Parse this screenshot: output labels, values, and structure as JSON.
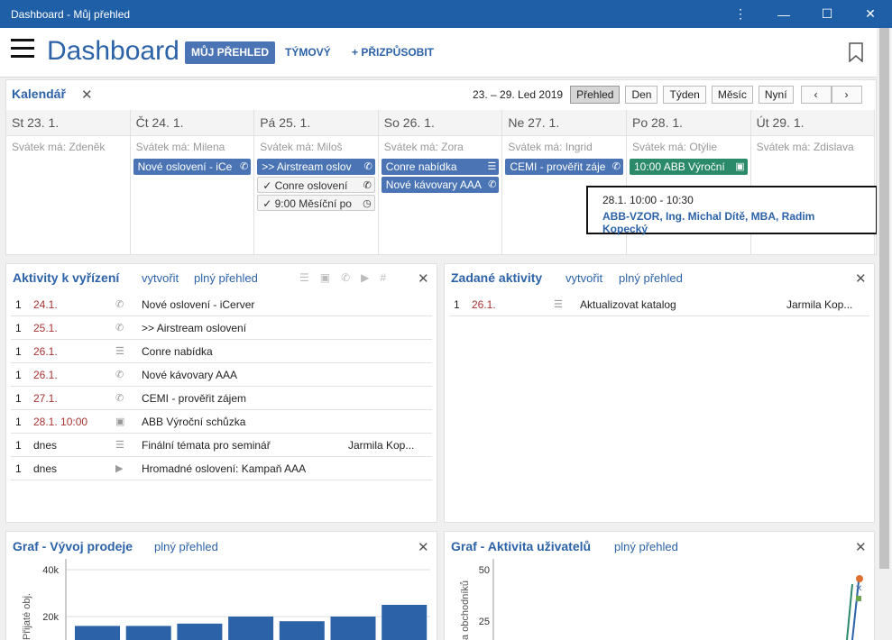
{
  "window": {
    "title": "Dashboard - Můj přehled"
  },
  "header": {
    "title": "Dashboard",
    "tab_my": "MŮJ PŘEHLED",
    "tab_team": "TÝMOVÝ",
    "tab_custom": "+ PŘIZPŮSOBIT"
  },
  "calendar": {
    "title": "Kalendář",
    "range": "23. – 29. Led 2019",
    "views": [
      "Přehled",
      "Den",
      "Týden",
      "Měsíc",
      "Nyní"
    ],
    "days": [
      {
        "label": "St 23. 1.",
        "nameday": "Svátek má: Zdeněk",
        "events": []
      },
      {
        "label": "Čt 24. 1.",
        "nameday": "Svátek má: Milena",
        "events": [
          {
            "text": "Nové oslovení - iCe",
            "style": "blue",
            "icon": "phone-icon"
          }
        ]
      },
      {
        "label": "Pá 25. 1.",
        "nameday": "Svátek má: Miloš",
        "events": [
          {
            "text": ">> Airstream oslov",
            "style": "blue",
            "icon": "phone-icon"
          },
          {
            "text": "✓  Conre oslovení",
            "style": "done",
            "icon": "phone-icon"
          },
          {
            "text": "✓  9:00 Měsíční po",
            "style": "done",
            "icon": "clock-icon"
          }
        ]
      },
      {
        "label": "So 26. 1.",
        "nameday": "Svátek má: Zora",
        "events": [
          {
            "text": "Conre nabídka",
            "style": "blue",
            "icon": "task-list-icon"
          },
          {
            "text": "Nové kávovary AAA",
            "style": "blue",
            "icon": "phone-icon"
          }
        ]
      },
      {
        "label": "Ne 27. 1.",
        "nameday": "Svátek má: Ingrid",
        "events": [
          {
            "text": "CEMI - prověřit záje",
            "style": "blue",
            "icon": "phone-icon"
          }
        ]
      },
      {
        "label": "Po 28. 1.",
        "nameday": "Svátek má: Otýlie",
        "events": [
          {
            "text": "10:00 ABB Výroční",
            "style": "green",
            "icon": "briefcase-icon"
          }
        ]
      },
      {
        "label": "Út 29. 1.",
        "nameday": "Svátek má: Zdislava",
        "events": []
      }
    ],
    "tooltip": {
      "time": "28.1. 10:00 - 10:30",
      "people": "ABB-VZOR, Ing. Michal Dítě, MBA, Radim Kopecký"
    }
  },
  "activities": {
    "title": "Aktivity k vyřízení",
    "create": "vytvořit",
    "overview": "plný přehled",
    "rows": [
      {
        "n": "1",
        "date": "24.1.",
        "red": true,
        "icon": "phone-icon",
        "text": "Nové oslovení - iCerver",
        "user": ""
      },
      {
        "n": "1",
        "date": "25.1.",
        "red": true,
        "icon": "phone-icon",
        "text": ">> Airstream oslovení",
        "user": ""
      },
      {
        "n": "1",
        "date": "26.1.",
        "red": true,
        "icon": "task-list-icon",
        "text": "Conre nabídka",
        "user": ""
      },
      {
        "n": "1",
        "date": "26.1.",
        "red": true,
        "icon": "phone-icon",
        "text": "Nové kávovary AAA",
        "user": ""
      },
      {
        "n": "1",
        "date": "27.1.",
        "red": true,
        "icon": "phone-icon",
        "text": "CEMI - prověřit zájem",
        "user": ""
      },
      {
        "n": "1",
        "date": "28.1. 10:00",
        "red": true,
        "icon": "briefcase-icon",
        "text": "ABB Výroční schůzka",
        "user": ""
      },
      {
        "n": "1",
        "date": "dnes",
        "red": false,
        "icon": "task-list-icon",
        "text": "Finální témata pro seminář",
        "user": "Jarmila Kop..."
      },
      {
        "n": "1",
        "date": "dnes",
        "red": false,
        "icon": "play-icon",
        "text": "Hromadné oslovení: Kampaň AAA",
        "user": ""
      }
    ]
  },
  "assigned": {
    "title": "Zadané aktivity",
    "create": "vytvořit",
    "overview": "plný přehled",
    "rows": [
      {
        "n": "1",
        "date": "26.1.",
        "icon": "task-list-icon",
        "text": "Aktualizovat katalog",
        "user": "Jarmila Kop..."
      }
    ]
  },
  "graph_sales": {
    "title": "Graf - Vývoj prodeje",
    "overview": "plný přehled",
    "chart_data": {
      "type": "bar",
      "ylabel": "Přijaté obj.",
      "yticks": [
        "40k",
        "20k"
      ],
      "ylim": [
        0,
        40000
      ],
      "values": [
        16000,
        16000,
        17000,
        20000,
        18000,
        20000,
        25000
      ]
    }
  },
  "graph_users": {
    "title": "Graf - Aktivita uživatelů",
    "overview": "plný přehled",
    "chart_data": {
      "type": "line",
      "ylabel": "a obchodníků",
      "yticks": [
        "50",
        "25"
      ]
    }
  },
  "colors": {
    "brand": "#2c62a8",
    "accent": "#4a74b4",
    "green": "#2a8a6a",
    "titlebar": "#1f5fa8",
    "overdue": "#a83232"
  }
}
